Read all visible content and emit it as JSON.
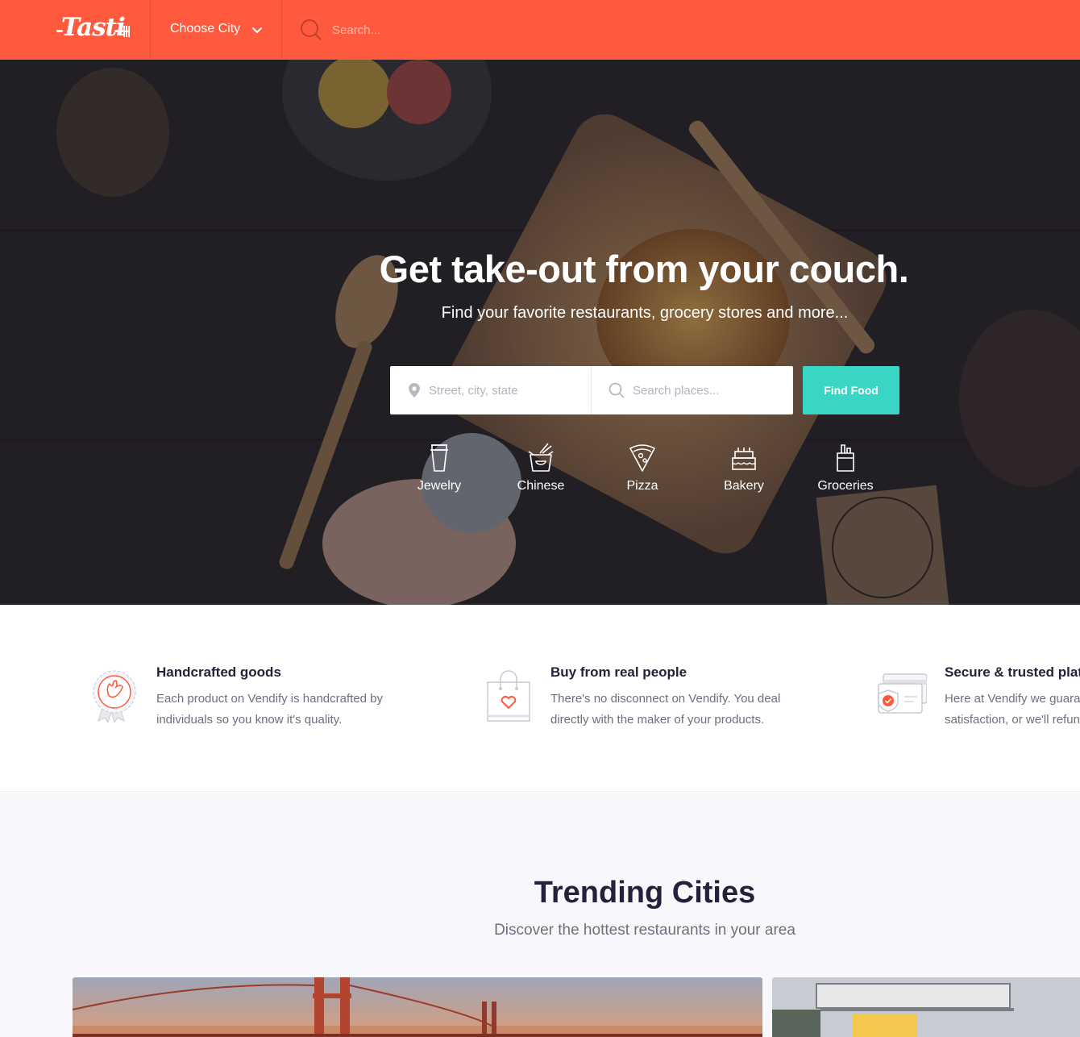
{
  "header": {
    "logo_text": "Tasti",
    "city_select_label": "Choose City",
    "search_placeholder": "Search..."
  },
  "hero": {
    "title": "Get take-out from your couch.",
    "subtitle": "Find your favorite restaurants, grocery stores and more...",
    "location_placeholder": "Street, city, state",
    "places_placeholder": "Search places...",
    "find_button": "Find Food",
    "categories": [
      {
        "label": "Jewelry",
        "icon": "cup-icon"
      },
      {
        "label": "Chinese",
        "icon": "takeout-box-icon"
      },
      {
        "label": "Pizza",
        "icon": "pizza-slice-icon"
      },
      {
        "label": "Bakery",
        "icon": "cake-icon"
      },
      {
        "label": "Groceries",
        "icon": "grocery-bag-icon"
      }
    ]
  },
  "features": [
    {
      "title": "Handcrafted goods",
      "description": "Each product on Vendify is handcrafted by individuals so you know it's quality.",
      "icon": "handcrafted-badge-icon"
    },
    {
      "title": "Buy from real people",
      "description": "There's no disconnect on Vendify. You deal directly with the maker of your products.",
      "icon": "shopping-bag-heart-icon"
    },
    {
      "title": "Secure & trusted platform",
      "description_line1": "Here at Vendify we guarantee",
      "description_line2": "satisfaction, or we'll refund",
      "icon": "secure-card-icon"
    }
  ],
  "trending": {
    "title": "Trending Cities",
    "subtitle": "Discover the hottest restaurants in your area"
  },
  "colors": {
    "brand": "#ff5a3d",
    "accent": "#3ad6c5",
    "heading": "#23223a",
    "body_text": "#6f6e80"
  }
}
